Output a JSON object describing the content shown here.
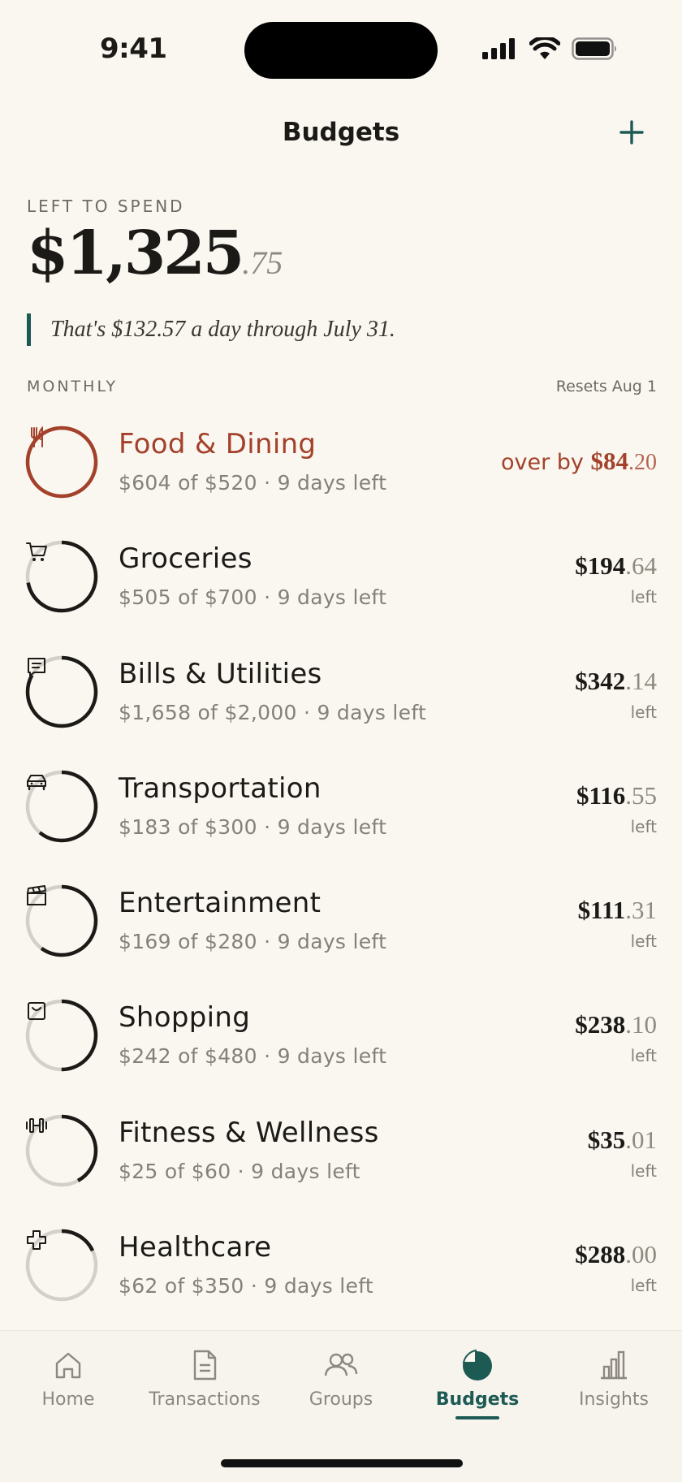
{
  "status_bar": {
    "time": "9:41"
  },
  "nav": {
    "title": "Budgets",
    "add_icon": "plus-icon"
  },
  "summary": {
    "label": "LEFT TO SPEND",
    "amount_whole": "$1,325",
    "amount_cents": ".75",
    "note": "That's $132.57 a day through July 31."
  },
  "section": {
    "label": "MONTHLY",
    "reset": "Resets Aug 1"
  },
  "colors": {
    "accent": "#1D5A53",
    "over": "#A3412B",
    "ring_track": "#D3D0C9",
    "ring_fill": "#1B1A17",
    "background": "#FAF7F1"
  },
  "budgets": [
    {
      "name": "Food & Dining",
      "detail": "$604 of $520 · 9 days left",
      "status": "over",
      "over_prefix": "over by",
      "amount_whole": "$84",
      "amount_cents": ".20",
      "icon": "fork-knife-icon",
      "progress": 1.0
    },
    {
      "name": "Groceries",
      "detail": "$505 of $700 · 9 days left",
      "status": "left",
      "amount_whole": "$194",
      "amount_cents": ".64",
      "left_label": "left",
      "icon": "cart-icon",
      "progress": 0.72
    },
    {
      "name": "Bills & Utilities",
      "detail": "$1,658 of $2,000 · 9 days left",
      "status": "left",
      "amount_whole": "$342",
      "amount_cents": ".14",
      "left_label": "left",
      "icon": "receipt-icon",
      "progress": 0.83
    },
    {
      "name": "Transportation",
      "detail": "$183 of $300 · 9 days left",
      "status": "left",
      "amount_whole": "$116",
      "amount_cents": ".55",
      "left_label": "left",
      "icon": "car-icon",
      "progress": 0.61
    },
    {
      "name": "Entertainment",
      "detail": "$169 of $280 · 9 days left",
      "status": "left",
      "amount_whole": "$111",
      "amount_cents": ".31",
      "left_label": "left",
      "icon": "clapperboard-icon",
      "progress": 0.6
    },
    {
      "name": "Shopping",
      "detail": "$242 of $480 · 9 days left",
      "status": "left",
      "amount_whole": "$238",
      "amount_cents": ".10",
      "left_label": "left",
      "icon": "shopping-bag-icon",
      "progress": 0.5
    },
    {
      "name": "Fitness & Wellness",
      "detail": "$25 of $60 · 9 days left",
      "status": "left",
      "amount_whole": "$35",
      "amount_cents": ".01",
      "left_label": "left",
      "icon": "dumbbell-icon",
      "progress": 0.42
    },
    {
      "name": "Healthcare",
      "detail": "$62 of $350 · 9 days left",
      "status": "left",
      "amount_whole": "$288",
      "amount_cents": ".00",
      "left_label": "left",
      "icon": "medical-cross-icon",
      "progress": 0.18
    }
  ],
  "tabs": [
    {
      "label": "Home",
      "icon": "home-icon",
      "active": false
    },
    {
      "label": "Transactions",
      "icon": "document-icon",
      "active": false
    },
    {
      "label": "Groups",
      "icon": "people-icon",
      "active": false
    },
    {
      "label": "Budgets",
      "icon": "pie-chart-icon",
      "active": true
    },
    {
      "label": "Insights",
      "icon": "bar-chart-icon",
      "active": false
    }
  ]
}
